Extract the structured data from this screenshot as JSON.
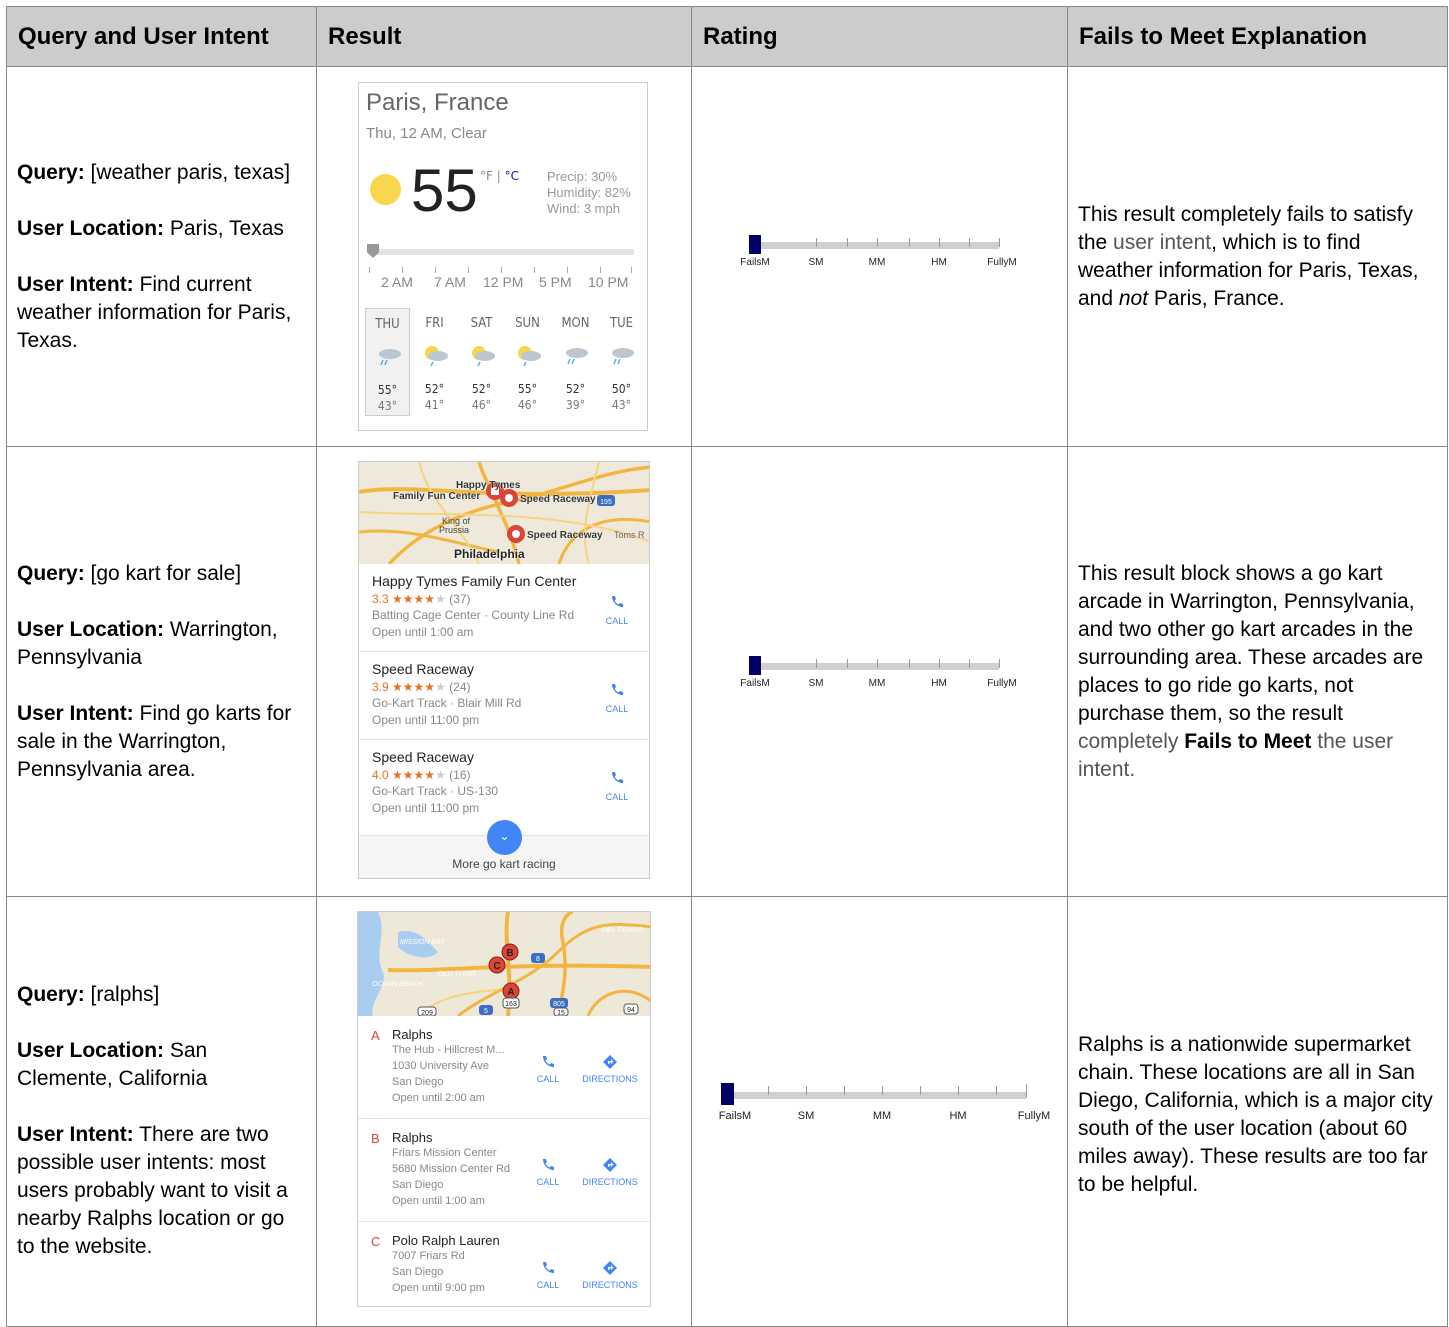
{
  "headers": [
    "Query and User Intent",
    "Result",
    "Rating",
    "Fails to Meet Explanation"
  ],
  "rows": [
    {
      "query_label": "Query:",
      "query": "[weather paris, texas]",
      "location_label": "User Location:",
      "location": "Paris, Texas",
      "intent_label": "User Intent:",
      "intent": "Find current weather information for Paris, Texas.",
      "explanation": {
        "a": "This result completely fails to satisfy the ",
        "b": "user intent",
        "c": ", which is to find weather information for Paris, Texas, and ",
        "d": "not",
        "e": " Paris, France."
      },
      "rating": {
        "value": "FailsM",
        "labels": [
          "FailsM",
          "SM",
          "MM",
          "HM",
          "FullyM"
        ]
      }
    },
    {
      "query_label": "Query:",
      "query": "[go kart for sale]",
      "location_label": "User Location:",
      "location": "Warrington, Pennsylvania",
      "intent_label": "User Intent:",
      "intent": "Find go karts for sale in the Warrington, Pennsylvania area.",
      "explanation": {
        "a": "This result block shows a go kart arcade in Warrington, Pennsylvania, and two other go kart arcades in the surrounding area.  These arcades are places to go ride go karts, not purchase them, so the result ",
        "b": "completely ",
        "c": "Fails to Meet",
        "d": " the user intent."
      },
      "rating": {
        "value": "FailsM",
        "labels": [
          "FailsM",
          "SM",
          "MM",
          "HM",
          "FullyM"
        ]
      }
    },
    {
      "query_label": "Query:",
      "query": "[ralphs]",
      "location_label": "User Location:",
      "location": "San Clemente, California",
      "intent_label": "User Intent:",
      "intent": "There are two possible user intents: most users probably want to visit a nearby Ralphs location or go to the website.",
      "explanation": {
        "a": "Ralphs is a nationwide supermarket chain.  These locations are all in San Diego, California, which is a major city south of the user location (about 60 miles away).  These results are too far to be helpful."
      },
      "rating": {
        "value": "FailsM",
        "labels": [
          "FailsM",
          "SM",
          "MM",
          "HM",
          "FullyM"
        ]
      }
    }
  ],
  "weather": {
    "city": "Paris, France",
    "time": "Thu, 12 AM, Clear",
    "temp": "55",
    "unit_f": "°F | ",
    "unit_c": "°C",
    "precip": "Precip: 30%",
    "humidity": "Humidity: 82%",
    "wind": "Wind: 3 mph",
    "hours": [
      "2 AM",
      "7 AM",
      "12 PM",
      "5 PM",
      "10 PM"
    ],
    "days": [
      {
        "name": "THU",
        "hi": "55°",
        "lo": "43°",
        "icon": "rain-cloud-icon"
      },
      {
        "name": "FRI",
        "hi": "52°",
        "lo": "41°",
        "icon": "partly-sunny-rain-icon"
      },
      {
        "name": "SAT",
        "hi": "52°",
        "lo": "46°",
        "icon": "partly-sunny-rain-icon"
      },
      {
        "name": "SUN",
        "hi": "55°",
        "lo": "46°",
        "icon": "partly-sunny-rain-icon"
      },
      {
        "name": "MON",
        "hi": "52°",
        "lo": "39°",
        "icon": "rain-cloud-icon"
      },
      {
        "name": "TUE",
        "hi": "50°",
        "lo": "43°",
        "icon": "rain-cloud-icon"
      }
    ]
  },
  "kart_map": {
    "labels": [
      "Happy Tymes",
      "Family Fun Center",
      "Speed Raceway",
      "King of",
      "Prussia",
      "Speed Raceway",
      "Toms R",
      "Philadelphia"
    ],
    "shield": "195"
  },
  "kart_places": [
    {
      "name": "Happy Tymes Family Fun Center",
      "rating": "3.3",
      "stars": "★★★★",
      "empty": "★",
      "count": "(37)",
      "type": "Batting Cage Center · County Line Rd",
      "open": "Open until 1:00 am",
      "call": "CALL"
    },
    {
      "name": "Speed Raceway",
      "rating": "3.9",
      "stars": "★★★★",
      "empty": "★",
      "count": "(24)",
      "type": "Go-Kart Track · Blair Mill Rd",
      "open": "Open until 11:00 pm",
      "call": "CALL"
    },
    {
      "name": "Speed Raceway",
      "rating": "4.0",
      "stars": "★★★★",
      "empty": "★",
      "count": "(16)",
      "type": "Go-Kart Track · US-130",
      "open": "Open until 11:00 pm",
      "call": "CALL"
    }
  ],
  "kart_more": {
    "chevron": "⌄",
    "label": "More go kart racing"
  },
  "ralphs_map": {
    "labels": [
      "MISSION BAY",
      "DEL CERRO",
      "OLD TOWN",
      "OCEAN BEACH"
    ],
    "pins": [
      "B",
      "C",
      "A"
    ],
    "shields": [
      "8",
      "163",
      "805",
      "15",
      "94",
      "209",
      "5"
    ]
  },
  "ralphs_places": [
    {
      "letter": "A",
      "name": "Ralphs",
      "lines": [
        "The Hub - Hillcrest M...",
        "1030 University Ave",
        "San Diego",
        "Open until 2:00 am"
      ],
      "call": "CALL",
      "dir": "DIRECTIONS"
    },
    {
      "letter": "B",
      "name": "Ralphs",
      "lines": [
        "Friars Mission Center",
        "5680 Mission Center Rd",
        "San Diego",
        "Open until 1:00 am"
      ],
      "call": "CALL",
      "dir": "DIRECTIONS"
    },
    {
      "letter": "C",
      "name": "Polo Ralph Lauren",
      "lines": [
        "7007 Friars Rd",
        "San Diego",
        "Open until 9:00 pm"
      ],
      "call": "CALL",
      "dir": "DIRECTIONS"
    }
  ],
  "colors": {
    "header_bg": "#cccccc",
    "rating_marker": "#000066",
    "link_blue": "#4285f4",
    "pin_red": "#db4437",
    "star_orange": "#e7711b"
  }
}
